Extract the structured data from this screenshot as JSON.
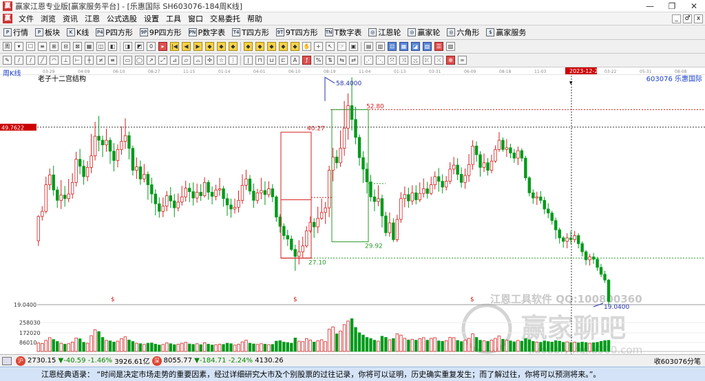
{
  "window": {
    "title": "赢家江恩专业版[赢家服务平台] - [乐惠国际  SH603076-184周K线]",
    "icon_name": "app-logo-icon",
    "controls": [
      "—",
      "❐",
      "✕"
    ]
  },
  "menu": {
    "items": [
      "文件",
      "浏览",
      "资讯",
      "江恩",
      "公式选股",
      "设置",
      "工具",
      "窗口",
      "交易委托",
      "帮助"
    ],
    "right_buttons": [
      "_",
      "♂",
      "x"
    ]
  },
  "tabs": [
    {
      "label": "行情",
      "icon": "P"
    },
    {
      "label": "板块",
      "icon": "P"
    },
    {
      "label": "K线",
      "icon": "K"
    },
    {
      "label": "P四方形",
      "icon": "P4"
    },
    {
      "label": "9P四方形",
      "icon": "9P"
    },
    {
      "label": "P数字表",
      "icon": "PN"
    },
    {
      "label": "T四方形",
      "icon": "T4"
    },
    {
      "label": "9T四方形",
      "icon": "9T"
    },
    {
      "label": "T数字表",
      "icon": "TN"
    },
    {
      "label": "江恩轮",
      "icon": "◎"
    },
    {
      "label": "赢家轮",
      "icon": "◎"
    },
    {
      "label": "六角形",
      "icon": "◎"
    },
    {
      "label": "赢家服务",
      "icon": "$"
    }
  ],
  "toolbar1": [
    {
      "t": "周",
      "c": ""
    },
    {
      "t": "▾",
      "c": ""
    },
    {
      "t": "☐",
      "c": ""
    },
    {
      "t": "≡",
      "c": ""
    },
    {
      "t": "⊞",
      "c": ""
    },
    {
      "t": "⊟",
      "c": ""
    },
    {
      "t": "⊠",
      "c": ""
    },
    {
      "t": "▦",
      "c": ""
    },
    {
      "t": "◫",
      "c": ""
    },
    {
      "t": "◧",
      "c": ""
    },
    {
      "t": "◨",
      "c": ""
    },
    {
      "t": "◩",
      "c": ""
    },
    {
      "t": "0",
      "c": ""
    },
    {
      "t": "▸",
      "c": "r"
    },
    {
      "t": "|◀",
      "c": "y"
    },
    {
      "t": "◀",
      "c": "y"
    },
    {
      "t": "▶",
      "c": "y"
    },
    {
      "t": "◆",
      "c": "y"
    },
    {
      "t": "◆",
      "c": "y"
    },
    {
      "t": "◆",
      "c": "y"
    },
    {
      "t": "◆",
      "c": "y"
    },
    {
      "t": "◆",
      "c": "y"
    },
    {
      "t": "◆",
      "c": "y"
    },
    {
      "t": "◆",
      "c": "y"
    },
    {
      "t": "◆",
      "c": "y"
    },
    {
      "t": "✋",
      "c": ""
    },
    {
      "t": "+",
      "c": ""
    },
    {
      "t": "↖",
      "c": ""
    },
    {
      "t": "☞",
      "c": ""
    },
    {
      "t": "▣",
      "c": ""
    },
    {
      "t": "▤",
      "c": ""
    },
    {
      "t": "▥",
      "c": ""
    },
    {
      "t": "⊡",
      "c": "b"
    },
    {
      "t": "▦",
      "c": "b"
    },
    {
      "t": "◪",
      "c": "b"
    },
    {
      "t": "▧",
      "c": "b"
    },
    {
      "t": "☰",
      "c": "r"
    },
    {
      "t": "▨",
      "c": ""
    }
  ],
  "toolbar2": [
    {
      "t": "✎",
      "c": ""
    },
    {
      "t": "/",
      "c": ""
    },
    {
      "t": "∕",
      "c": ""
    },
    {
      "t": "╱",
      "c": ""
    },
    {
      "t": "◠",
      "c": ""
    },
    {
      "t": "⊥",
      "c": ""
    },
    {
      "t": "⊢",
      "c": ""
    },
    {
      "t": "┼",
      "c": ""
    },
    {
      "t": "≠",
      "c": ""
    },
    {
      "t": "≡",
      "c": ""
    },
    {
      "t": "▭",
      "c": ""
    },
    {
      "t": "◯",
      "c": ""
    },
    {
      "t": "↗",
      "c": ""
    },
    {
      "t": "⤢",
      "c": ""
    },
    {
      "t": "⊿",
      "c": ""
    },
    {
      "t": "▱",
      "c": ""
    },
    {
      "t": "⌓",
      "c": ""
    },
    {
      "t": "✣",
      "c": ""
    },
    {
      "t": "☆",
      "c": ""
    },
    {
      "t": "⋮",
      "c": ""
    },
    {
      "t": "|",
      "c": ""
    },
    {
      "t": "⊓",
      "c": ""
    },
    {
      "t": "⊔",
      "c": ""
    },
    {
      "t": "⊏",
      "c": ""
    },
    {
      "t": "A",
      "c": ""
    },
    {
      "t": "ƒ",
      "c": "r"
    },
    {
      "t": "%",
      "c": ""
    },
    {
      "t": "⇅",
      "c": ""
    },
    {
      "t": "⇆",
      "c": ""
    },
    {
      "t": "⇄",
      "c": ""
    },
    {
      "t": "⋰",
      "c": ""
    },
    {
      "t": "⋱",
      "c": ""
    },
    {
      "t": "⤧",
      "c": ""
    },
    {
      "t": "⤨",
      "c": ""
    },
    {
      "t": "⤩",
      "c": ""
    },
    {
      "t": "⤪",
      "c": ""
    },
    {
      "t": "⤫",
      "c": ""
    },
    {
      "t": "⊕",
      "c": "r"
    },
    {
      "t": "∞",
      "c": ""
    }
  ],
  "chart_data": {
    "type": "candlestick",
    "period_label": "周K线",
    "indicator_label": "老子十二宫结构",
    "code_label": "603076  乐惠国际",
    "date_ticks": [
      "03-29",
      "04-09",
      "06-10",
      "08-27",
      "11-15",
      "01-14",
      "04-01",
      "06-10",
      "08-19",
      "11-04",
      "01-13",
      "03-31",
      "06-09",
      "08-18",
      "11-03",
      "2023-12-22",
      "03-22",
      "05-31",
      "08-08"
    ],
    "highlighted_date": "2023-12-22",
    "crosshair_price": "49.7622",
    "price_axis_label": "19.0400",
    "annotations": {
      "peak": "58.4000",
      "box_top": "52.80",
      "box_bottom": "29.92",
      "low_line": "27.10",
      "mid_mark": "40.27",
      "last_low": "19.0400"
    },
    "dividend_marks": [
      "$",
      "$",
      "$"
    ],
    "volume_axis": [
      "258030",
      "172020",
      "86010"
    ],
    "watermark_lines": [
      "江恩工具软件  QQ:100800360",
      "赢家聊吧",
      "jiaoba.yingjia360.com"
    ],
    "candles": [
      [
        30.1,
        34.3,
        34.5,
        29.2
      ],
      [
        34.3,
        35.2,
        36.1,
        33.6
      ],
      [
        35.2,
        39.8,
        41.2,
        34.8
      ],
      [
        39.8,
        41.5,
        42.6,
        38.9
      ],
      [
        41.5,
        38.9,
        43.1,
        37.9
      ],
      [
        38.9,
        37.1,
        39.5,
        35.8
      ],
      [
        37.1,
        38.0,
        40.6,
        35.6
      ],
      [
        38.0,
        37.4,
        39.6,
        36.0
      ],
      [
        37.4,
        38.2,
        40.8,
        36.8
      ],
      [
        38.2,
        40.2,
        41.8,
        37.4
      ],
      [
        40.2,
        44.2,
        45.5,
        39.5
      ],
      [
        44.2,
        43.0,
        46.0,
        41.6
      ],
      [
        43.0,
        41.2,
        44.1,
        39.8
      ],
      [
        41.2,
        42.8,
        43.9,
        40.4
      ],
      [
        42.8,
        44.8,
        48.6,
        41.8
      ],
      [
        44.8,
        48.2,
        50.7,
        44.0
      ],
      [
        48.2,
        47.5,
        51.7,
        45.6
      ],
      [
        47.5,
        46.7,
        48.3,
        44.6
      ],
      [
        46.7,
        47.5,
        49.5,
        45.5
      ],
      [
        47.5,
        45.6,
        48.0,
        43.4
      ],
      [
        45.6,
        44.0,
        47.0,
        42.1
      ],
      [
        44.0,
        45.9,
        46.8,
        42.8
      ],
      [
        45.9,
        47.3,
        49.9,
        45.0
      ],
      [
        47.3,
        48.3,
        51.3,
        46.0
      ],
      [
        48.3,
        46.1,
        49.0,
        44.2
      ],
      [
        46.1,
        42.3,
        46.6,
        41.4
      ],
      [
        42.3,
        42.9,
        44.5,
        40.8
      ],
      [
        42.9,
        40.8,
        44.0,
        39.8
      ],
      [
        40.8,
        41.6,
        43.4,
        40.2
      ],
      [
        41.6,
        39.8,
        42.1,
        37.2
      ],
      [
        39.8,
        38.2,
        41.0,
        36.6
      ],
      [
        38.2,
        36.5,
        39.0,
        34.5
      ],
      [
        36.5,
        35.2,
        37.6,
        34.1
      ],
      [
        35.2,
        36.1,
        37.6,
        34.2
      ],
      [
        36.1,
        37.9,
        38.7,
        35.2
      ],
      [
        37.9,
        37.0,
        39.4,
        35.8
      ],
      [
        37.0,
        35.8,
        38.2,
        34.2
      ],
      [
        35.8,
        36.8,
        38.3,
        35.2
      ],
      [
        36.8,
        37.7,
        39.6,
        36.2
      ],
      [
        37.7,
        39.2,
        40.5,
        36.9
      ],
      [
        39.2,
        38.6,
        40.1,
        36.8
      ],
      [
        38.6,
        37.5,
        40.2,
        36.2
      ],
      [
        37.5,
        38.5,
        40.0,
        36.7
      ],
      [
        38.5,
        37.9,
        39.9,
        37.0
      ],
      [
        37.9,
        40.2,
        41.1,
        37.6
      ],
      [
        40.2,
        38.5,
        40.6,
        37.2
      ],
      [
        38.5,
        37.8,
        39.5,
        36.4
      ],
      [
        37.8,
        38.9,
        39.8,
        37.1
      ],
      [
        38.9,
        39.1,
        41.0,
        37.9
      ],
      [
        39.1,
        37.4,
        39.6,
        36.0
      ],
      [
        37.4,
        36.3,
        38.3,
        34.4
      ],
      [
        36.3,
        35.6,
        37.4,
        34.1
      ],
      [
        35.6,
        35.9,
        37.4,
        34.8
      ],
      [
        35.9,
        37.1,
        38.8,
        35.0
      ],
      [
        37.1,
        39.7,
        41.6,
        36.5
      ],
      [
        39.7,
        40.8,
        42.4,
        38.9
      ],
      [
        40.8,
        38.7,
        41.5,
        38.1
      ],
      [
        38.7,
        37.1,
        40.0,
        35.8
      ],
      [
        37.1,
        38.4,
        39.1,
        36.5
      ],
      [
        38.4,
        38.8,
        41.0,
        37.3
      ],
      [
        38.8,
        38.1,
        40.4,
        36.3
      ],
      [
        38.1,
        39.1,
        40.4,
        37.6
      ],
      [
        39.1,
        37.7,
        39.9,
        36.8
      ],
      [
        37.7,
        34.2,
        38.0,
        33.4
      ],
      [
        34.2,
        32.6,
        34.7,
        31.5
      ],
      [
        32.6,
        31.0,
        33.1,
        30.3
      ],
      [
        31.0,
        30.4,
        32.0,
        29.2
      ],
      [
        30.4,
        28.6,
        31.0,
        28.3
      ],
      [
        28.6,
        27.4,
        29.4,
        24.9
      ],
      [
        27.4,
        28.2,
        30.2,
        26.0
      ],
      [
        28.2,
        29.2,
        30.8,
        27.2
      ],
      [
        29.2,
        31.8,
        32.6,
        28.9
      ],
      [
        31.8,
        33.3,
        34.3,
        31.5
      ],
      [
        33.3,
        32.5,
        34.0,
        30.6
      ],
      [
        32.5,
        34.0,
        36.0,
        31.4
      ],
      [
        34.0,
        35.0,
        37.4,
        33.7
      ],
      [
        35.0,
        35.8,
        36.8,
        33.0
      ],
      [
        35.8,
        42.3,
        43.1,
        34.2
      ],
      [
        42.3,
        44.6,
        46.2,
        40.4
      ],
      [
        44.6,
        43.6,
        45.8,
        42.6
      ],
      [
        43.6,
        46.1,
        49.2,
        42.9
      ],
      [
        46.1,
        49.6,
        54.3,
        44.8
      ],
      [
        49.6,
        53.5,
        55.6,
        47.6
      ],
      [
        53.5,
        51.1,
        58.4,
        49.2
      ],
      [
        51.1,
        48.0,
        53.3,
        46.8
      ],
      [
        48.0,
        44.5,
        48.5,
        43.1
      ],
      [
        44.5,
        42.5,
        45.6,
        40.1
      ],
      [
        42.5,
        40.3,
        43.6,
        38.3
      ],
      [
        40.3,
        37.7,
        41.5,
        36.9
      ],
      [
        37.7,
        36.9,
        39.0,
        35.2
      ],
      [
        36.9,
        37.4,
        39.7,
        36.1
      ],
      [
        37.4,
        34.4,
        38.1,
        32.4
      ],
      [
        34.4,
        31.5,
        35.1,
        30.9
      ],
      [
        31.5,
        33.2,
        35.0,
        30.8
      ],
      [
        33.2,
        30.3,
        34.0,
        29.9
      ],
      [
        30.3,
        33.8,
        34.6,
        29.9
      ],
      [
        33.8,
        37.4,
        38.5,
        33.2
      ],
      [
        37.4,
        38.1,
        39.5,
        35.9
      ],
      [
        38.1,
        37.0,
        39.3,
        35.8
      ],
      [
        37.0,
        38.4,
        39.7,
        36.3
      ],
      [
        38.4,
        37.2,
        39.7,
        36.4
      ],
      [
        37.2,
        38.3,
        40.2,
        36.8
      ],
      [
        38.3,
        39.1,
        40.9,
        37.6
      ],
      [
        39.1,
        38.3,
        40.3,
        37.4
      ],
      [
        38.3,
        39.8,
        41.2,
        38.0
      ],
      [
        39.8,
        41.2,
        42.1,
        39.0
      ],
      [
        41.2,
        40.4,
        42.7,
        38.6
      ],
      [
        40.4,
        39.4,
        41.6,
        38.3
      ],
      [
        39.4,
        40.4,
        41.3,
        38.8
      ],
      [
        40.4,
        42.5,
        43.7,
        39.9
      ],
      [
        42.5,
        43.2,
        44.6,
        41.6
      ],
      [
        43.2,
        41.6,
        44.4,
        40.6
      ],
      [
        41.6,
        40.2,
        42.8,
        39.3
      ],
      [
        40.2,
        41.4,
        42.6,
        39.1
      ],
      [
        41.4,
        43.3,
        45.1,
        40.3
      ],
      [
        43.3,
        46.5,
        47.5,
        42.4
      ],
      [
        46.5,
        45.0,
        47.3,
        43.8
      ],
      [
        45.0,
        42.8,
        45.6,
        41.2
      ],
      [
        42.8,
        43.6,
        45.2,
        42.0
      ],
      [
        43.6,
        42.3,
        44.4,
        41.4
      ],
      [
        42.3,
        43.9,
        45.0,
        41.8
      ],
      [
        43.9,
        45.9,
        46.6,
        43.6
      ],
      [
        45.9,
        47.5,
        48.9,
        45.5
      ],
      [
        47.5,
        45.9,
        48.0,
        45.5
      ],
      [
        45.9,
        46.2,
        47.7,
        44.6
      ],
      [
        46.2,
        45.3,
        46.9,
        44.4
      ],
      [
        45.3,
        44.4,
        46.0,
        43.6
      ],
      [
        44.4,
        45.7,
        46.4,
        43.2
      ],
      [
        45.7,
        44.4,
        46.1,
        43.8
      ],
      [
        44.4,
        41.0,
        44.8,
        40.5
      ],
      [
        41.0,
        38.4,
        41.3,
        37.8
      ],
      [
        38.4,
        37.5,
        39.0,
        36.5
      ],
      [
        37.5,
        37.7,
        38.6,
        36.3
      ],
      [
        37.7,
        37.1,
        38.7,
        36.5
      ],
      [
        37.1,
        35.6,
        37.7,
        34.7
      ],
      [
        35.6,
        34.9,
        36.6,
        34.0
      ],
      [
        34.9,
        33.6,
        35.3,
        32.9
      ],
      [
        33.6,
        32.0,
        34.1,
        30.4
      ],
      [
        32.0,
        30.6,
        32.4,
        29.6
      ],
      [
        30.6,
        30.0,
        30.9,
        28.9
      ],
      [
        30.0,
        30.6,
        31.4,
        28.8
      ],
      [
        30.6,
        30.3,
        31.8,
        29.5
      ],
      [
        30.3,
        31.0,
        31.8,
        29.8
      ],
      [
        31.0,
        29.6,
        31.4,
        28.8
      ],
      [
        29.6,
        28.2,
        30.0,
        27.4
      ],
      [
        28.2,
        26.8,
        28.5,
        25.9
      ],
      [
        26.8,
        27.3,
        27.8,
        25.8
      ],
      [
        27.3,
        26.9,
        28.0,
        26.1
      ],
      [
        26.9,
        25.5,
        27.3,
        24.9
      ],
      [
        25.5,
        24.3,
        26.1,
        23.8
      ],
      [
        24.3,
        23.3,
        24.9,
        22.8
      ],
      [
        23.3,
        19.6,
        23.5,
        19.0
      ]
    ],
    "volumes": [
      72,
      68,
      95,
      118,
      102,
      85,
      70,
      62,
      66,
      80,
      115,
      108,
      78,
      70,
      135,
      185,
      170,
      120,
      95,
      90,
      80,
      88,
      110,
      125,
      98,
      85,
      70,
      66,
      60,
      70,
      72,
      62,
      55,
      60,
      72,
      66,
      58,
      62,
      70,
      78,
      64,
      60,
      66,
      58,
      74,
      62,
      55,
      58,
      62,
      60,
      70,
      66,
      54,
      62,
      82,
      96,
      70,
      64,
      60,
      66,
      62,
      58,
      60,
      88,
      92,
      80,
      76,
      70,
      115,
      88,
      84,
      110,
      98,
      80,
      92,
      100,
      84,
      190,
      210,
      150,
      175,
      230,
      260,
      280,
      205,
      160,
      140,
      120,
      110,
      96,
      88,
      130,
      120,
      100,
      110,
      150,
      140,
      112,
      98,
      104,
      96,
      110,
      118,
      96,
      112,
      118,
      90,
      86,
      92,
      120,
      118,
      94,
      84,
      96,
      112,
      150,
      120,
      96,
      90,
      86,
      98,
      112,
      132,
      104,
      96,
      90,
      82,
      94,
      88,
      110,
      100,
      86,
      80,
      78,
      90,
      84,
      80,
      92,
      88,
      78,
      82,
      76,
      80,
      74,
      80,
      76,
      70,
      74,
      78,
      86,
      92,
      95
    ]
  },
  "status": {
    "index1": "2730.15",
    "change1": "▼-40.59",
    "pct1": "-1.46%",
    "amount1": "3926.61亿",
    "badge2": "深",
    "index2": "8055.77",
    "change2": "▼-184.71",
    "pct2": "-2.24%",
    "amount2": "4130.26",
    "right": "收603076分笔"
  },
  "quote": {
    "text": "江恩经典语录：  “时间是决定市场走势的重要因素，经过详细研究大市及个别股票的过往记录，你将可以证明，历史确实重复发生；而了解过往，你将可以预测将来。”。"
  },
  "colors": {
    "up": "#d42020",
    "down": "#009a1a",
    "volume_up": "#d42020",
    "volume_down": "#009a1a",
    "highlight": "#cc0000"
  }
}
